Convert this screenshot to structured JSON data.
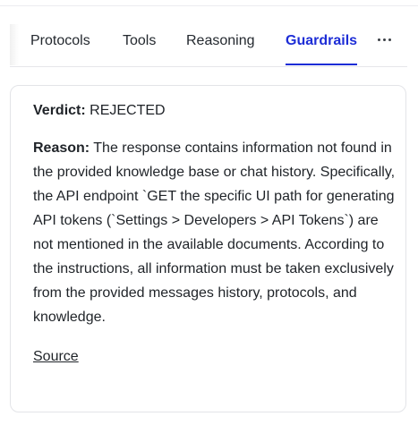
{
  "tabs": {
    "protocols": "Protocols",
    "tools": "Tools",
    "reasoning": "Reasoning",
    "guardrails": "Guardrails"
  },
  "verdict": {
    "label": "Verdict:",
    "value": "REJECTED"
  },
  "reason": {
    "label": "Reason:",
    "text": "The response contains information not found in the provided knowledge base or chat history. Specifically, the API endpoint `GET the specific UI path for generating API tokens (`Settings > Developers > API Tokens`) are not mentioned in the available documents. According to the instructions, all information must be taken exclusively from the provided messages history, protocols, and knowledge."
  },
  "source_link": "Source",
  "icons": {
    "more": "more-horizontal-icon"
  },
  "colors": {
    "accent": "#1d2dd6"
  }
}
